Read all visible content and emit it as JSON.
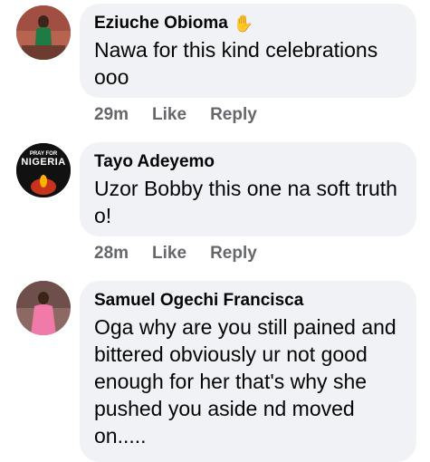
{
  "comments": [
    {
      "author": "Eziuche Obioma",
      "author_badge": "wave-hand-icon",
      "text": "Nawa for this kind celebrations ooo",
      "time": "29m",
      "like": "Like",
      "reply": "Reply"
    },
    {
      "author": "Tayo Adeyemo",
      "avatar_text_top": "PRAY FOR",
      "avatar_text_main": "NIGERIA",
      "text": "Uzor Bobby this one na soft truth o!",
      "time": "28m",
      "like": "Like",
      "reply": "Reply"
    },
    {
      "author": "Samuel Ogechi Francisca",
      "text": "Oga why are you still pained and bittered obviously ur not good enough for her that's why she pushed you aside nd moved on....."
    }
  ],
  "colors": {
    "bubble": "#f0f2f5",
    "meta": "#65676b",
    "text": "#050505"
  }
}
